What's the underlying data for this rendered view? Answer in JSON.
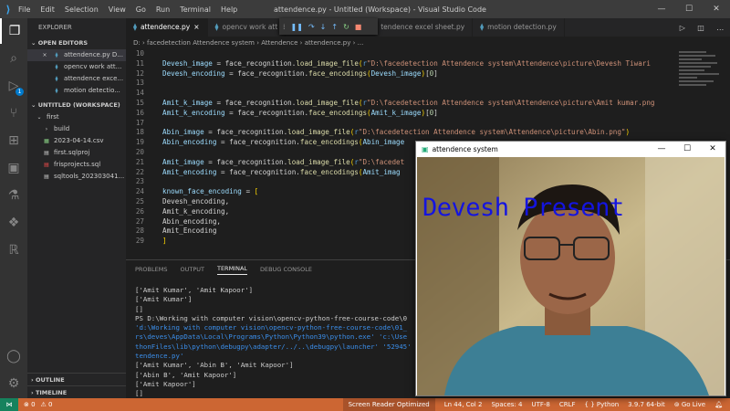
{
  "titlebar": {
    "menu": [
      "File",
      "Edit",
      "Selection",
      "View",
      "Go",
      "Run",
      "Terminal",
      "Help"
    ],
    "window_title": "attendence.py - Untitled (Workspace) - Visual Studio Code"
  },
  "sidebar": {
    "title": "EXPLORER",
    "open_editors_label": "OPEN EDITORS",
    "open_editors": [
      {
        "close": "×",
        "name": "attendence.py  D..."
      },
      {
        "name": "opencv work att..."
      },
      {
        "name": "attendence exce..."
      },
      {
        "name": "motion detectio..."
      }
    ],
    "workspace_label": "UNTITLED (WORKSPACE)",
    "tree": [
      {
        "chev": "⌄",
        "name": "first"
      },
      {
        "chev": "›",
        "name": "build"
      },
      {
        "name": "2023-04-14.csv"
      },
      {
        "name": "first.sqlproj"
      },
      {
        "name": "frisprojects.sql"
      },
      {
        "name": "sqltools_202303041..."
      }
    ],
    "outline_label": "OUTLINE",
    "timeline_label": "TIMELINE"
  },
  "activity_badge": "1",
  "tabs": [
    {
      "label": "attendence.py",
      "close": "×"
    },
    {
      "label": "opencv work att"
    },
    {
      "label": "tendence excel sheet.py"
    },
    {
      "label": "motion detection.py"
    }
  ],
  "breadcrumb": "D: › facedetection Attendence system › Attendence › attendence.py › ...",
  "code_lines": [
    {
      "n": "10",
      "parts": []
    },
    {
      "n": "11",
      "parts": [
        [
          "v",
          "Devesh_image"
        ],
        [
          "tx",
          " = face_recognition."
        ],
        [
          "f",
          "load_image_file"
        ],
        [
          "p",
          "("
        ],
        [
          "k",
          "r"
        ],
        [
          "s",
          "\"D:\\facedetection Attendence system\\Attendence\\picture\\Devesh Tiwari"
        ]
      ]
    },
    {
      "n": "12",
      "parts": [
        [
          "v",
          "Devesh_encoding"
        ],
        [
          "tx",
          " = face_recognition."
        ],
        [
          "f",
          "face_encodings"
        ],
        [
          "p",
          "("
        ],
        [
          "v",
          "Devesh_image"
        ],
        [
          "p",
          ")"
        ],
        [
          "tx",
          "["
        ],
        [
          "n",
          "0"
        ],
        [
          "tx",
          "]"
        ]
      ]
    },
    {
      "n": "13",
      "parts": []
    },
    {
      "n": "14",
      "parts": []
    },
    {
      "n": "15",
      "parts": [
        [
          "v",
          "Amit_k_image"
        ],
        [
          "tx",
          " = face_recognition."
        ],
        [
          "f",
          "load_image_file"
        ],
        [
          "p",
          "("
        ],
        [
          "k",
          "r"
        ],
        [
          "s",
          "\"D:\\facedetection Attendence system\\Attendence\\picture\\Amit kumar.png"
        ]
      ]
    },
    {
      "n": "16",
      "parts": [
        [
          "v",
          "Amit_k_encoding"
        ],
        [
          "tx",
          " = face_recognition."
        ],
        [
          "f",
          "face_encodings"
        ],
        [
          "p",
          "("
        ],
        [
          "v",
          "Amit_k_image"
        ],
        [
          "p",
          ")"
        ],
        [
          "tx",
          "["
        ],
        [
          "n",
          "0"
        ],
        [
          "tx",
          "]"
        ]
      ]
    },
    {
      "n": "17",
      "parts": []
    },
    {
      "n": "18",
      "parts": [
        [
          "v",
          "Abin_image"
        ],
        [
          "tx",
          " = face_recognition."
        ],
        [
          "f",
          "load_image_file"
        ],
        [
          "p",
          "("
        ],
        [
          "k",
          "r"
        ],
        [
          "s",
          "\"D:\\facedetection Attendence system\\Attendence\\picture\\Abin.png\""
        ],
        [
          "p",
          ")"
        ]
      ]
    },
    {
      "n": "19",
      "parts": [
        [
          "v",
          "Abin_encoding"
        ],
        [
          "tx",
          " = face_recognition."
        ],
        [
          "f",
          "face_encodings"
        ],
        [
          "p",
          "("
        ],
        [
          "v",
          "Abin_image"
        ]
      ]
    },
    {
      "n": "20",
      "parts": []
    },
    {
      "n": "21",
      "parts": [
        [
          "v",
          "Amit_image"
        ],
        [
          "tx",
          " = face_recognition."
        ],
        [
          "f",
          "load_image_file"
        ],
        [
          "p",
          "("
        ],
        [
          "k",
          "r"
        ],
        [
          "s",
          "\"D:\\facedet"
        ]
      ]
    },
    {
      "n": "22",
      "parts": [
        [
          "v",
          "Amit_encoding"
        ],
        [
          "tx",
          " = face_recognition."
        ],
        [
          "f",
          "face_encodings"
        ],
        [
          "p",
          "("
        ],
        [
          "v",
          "Amit_imag"
        ]
      ]
    },
    {
      "n": "23",
      "parts": []
    },
    {
      "n": "24",
      "parts": [
        [
          "v",
          "known_face_encoding"
        ],
        [
          "tx",
          " = "
        ],
        [
          "p",
          "["
        ]
      ]
    },
    {
      "n": "25",
      "parts": [
        [
          "tx",
          "Devesh_encoding,"
        ]
      ]
    },
    {
      "n": "26",
      "parts": [
        [
          "tx",
          "Amit_k_encoding,"
        ]
      ]
    },
    {
      "n": "27",
      "parts": [
        [
          "tx",
          "Abin_encoding,"
        ]
      ]
    },
    {
      "n": "28",
      "parts": [
        [
          "tx",
          "Amit_Encoding"
        ]
      ]
    },
    {
      "n": "29",
      "parts": [
        [
          "p",
          "]"
        ]
      ]
    }
  ],
  "panel_tabs": [
    "PROBLEMS",
    "OUTPUT",
    "TERMINAL",
    "DEBUG CONSOLE"
  ],
  "terminal_lines": [
    {
      "t": "['Amit Kumar', 'Amit Kapoor']",
      "c": ""
    },
    {
      "t": "['Amit Kumar']",
      "c": ""
    },
    {
      "t": "[]",
      "c": ""
    },
    {
      "t": "PS D:\\Working with computer vision\\opencv-python-free-course-code\\0",
      "c": ""
    },
    {
      "t": "'d:\\Working with computer vision\\opencv-python-free-course-code\\01_",
      "c": "blue"
    },
    {
      "t": "rs\\deves\\AppData\\Local\\Programs\\Python\\Python39\\python.exe' 'c:\\Use",
      "c": "blue"
    },
    {
      "t": "thonFiles\\lib\\python\\debugpy\\adapter/../..\\debugpy\\launcher' '52945'",
      "c": "blue"
    },
    {
      "t": "tendence.py'",
      "c": "blue"
    },
    {
      "t": "['Amit Kumar', 'Abin B', 'Amit Kapoor']",
      "c": ""
    },
    {
      "t": "['Abin B', 'Amit Kapoor']",
      "c": ""
    },
    {
      "t": "['Amit Kapoor']",
      "c": ""
    },
    {
      "t": "[]",
      "c": ""
    }
  ],
  "statusbar": {
    "errors": "⊗ 0",
    "warnings": "⚠ 0",
    "screen_reader": "Screen Reader Optimized",
    "position": "Ln 44, Col 2",
    "spaces": "Spaces: 4",
    "encoding": "UTF-8",
    "eol": "CRLF",
    "language": "Python",
    "interpreter": "3.9.7 64-bit",
    "golive": "Go Live"
  },
  "camera_window": {
    "title": "attendence system",
    "overlay_text": "Devesh Present"
  }
}
